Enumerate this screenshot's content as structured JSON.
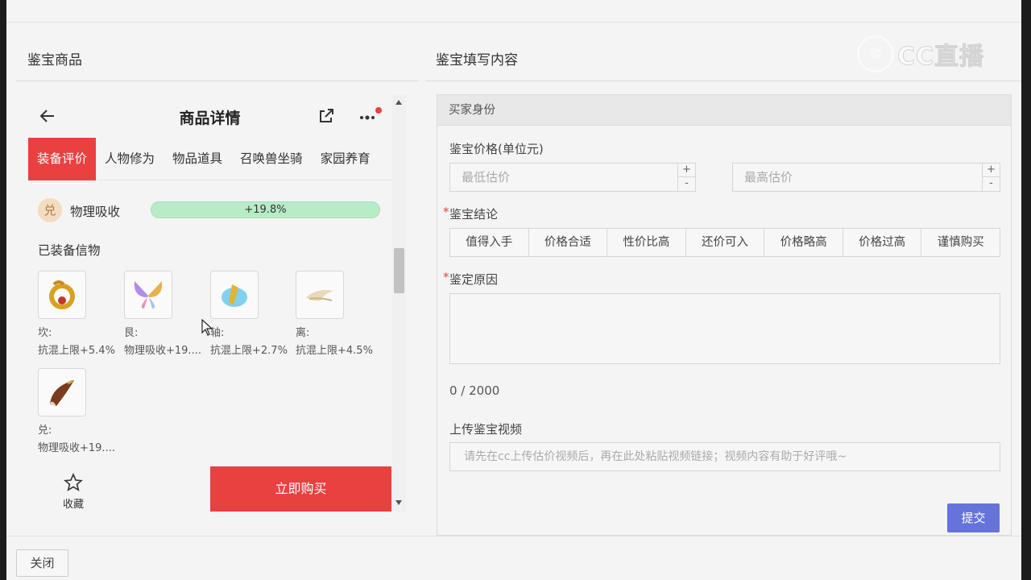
{
  "left_panel": {
    "title": "鉴宝商品"
  },
  "right_panel": {
    "title": "鉴宝填写内容"
  },
  "watermark": {
    "text": "CC直播"
  },
  "phone": {
    "title": "商品详情",
    "tabs": [
      "装备评价",
      "人物修为",
      "物品道具",
      "召唤兽坐骑",
      "家园养育"
    ],
    "active_tab": "装备评价",
    "attribute": {
      "badge": "兑",
      "label": "物理吸收",
      "value": "+19.8%",
      "fill_percent": 100
    },
    "equipped_title": "已装备信物",
    "items": [
      {
        "position": "坎:",
        "attr": "抗混上限+5.4%",
        "icon": "gold-ring-icon"
      },
      {
        "position": "艮:",
        "attr": "物理吸收+19....",
        "icon": "butterfly-icon"
      },
      {
        "position": "轴:",
        "attr": "抗混上限+2.7%",
        "icon": "blue-crystal-icon"
      },
      {
        "position": "离:",
        "attr": "抗混上限+4.5%",
        "icon": "crane-icon"
      },
      {
        "position": "兑:",
        "attr": "物理吸收+19....",
        "icon": "horn-icon"
      }
    ],
    "favorite_label": "收藏",
    "buy_label": "立即购买"
  },
  "form": {
    "section_title": "买家身份",
    "price_label": "鉴宝价格(单位元)",
    "min_placeholder": "最低估价",
    "max_placeholder": "最高估价",
    "conclusion_label": "鉴宝结论",
    "conclusions": [
      "值得入手",
      "价格合适",
      "性价比高",
      "还价可入",
      "价格略高",
      "价格过高",
      "谨慎购买"
    ],
    "reason_label": "鉴定原因",
    "counter": "0 / 2000",
    "video_label": "上传鉴宝视频",
    "video_placeholder": "请先在cc上传估价视频后，再在此处粘贴视频链接；视频内容有助于好评哦~",
    "submit_label": "提交"
  },
  "footer": {
    "close_label": "关闭"
  },
  "colors": {
    "accent_red": "#e94040",
    "submit_blue": "#6673db",
    "bar_green": "#b7ecc6"
  }
}
